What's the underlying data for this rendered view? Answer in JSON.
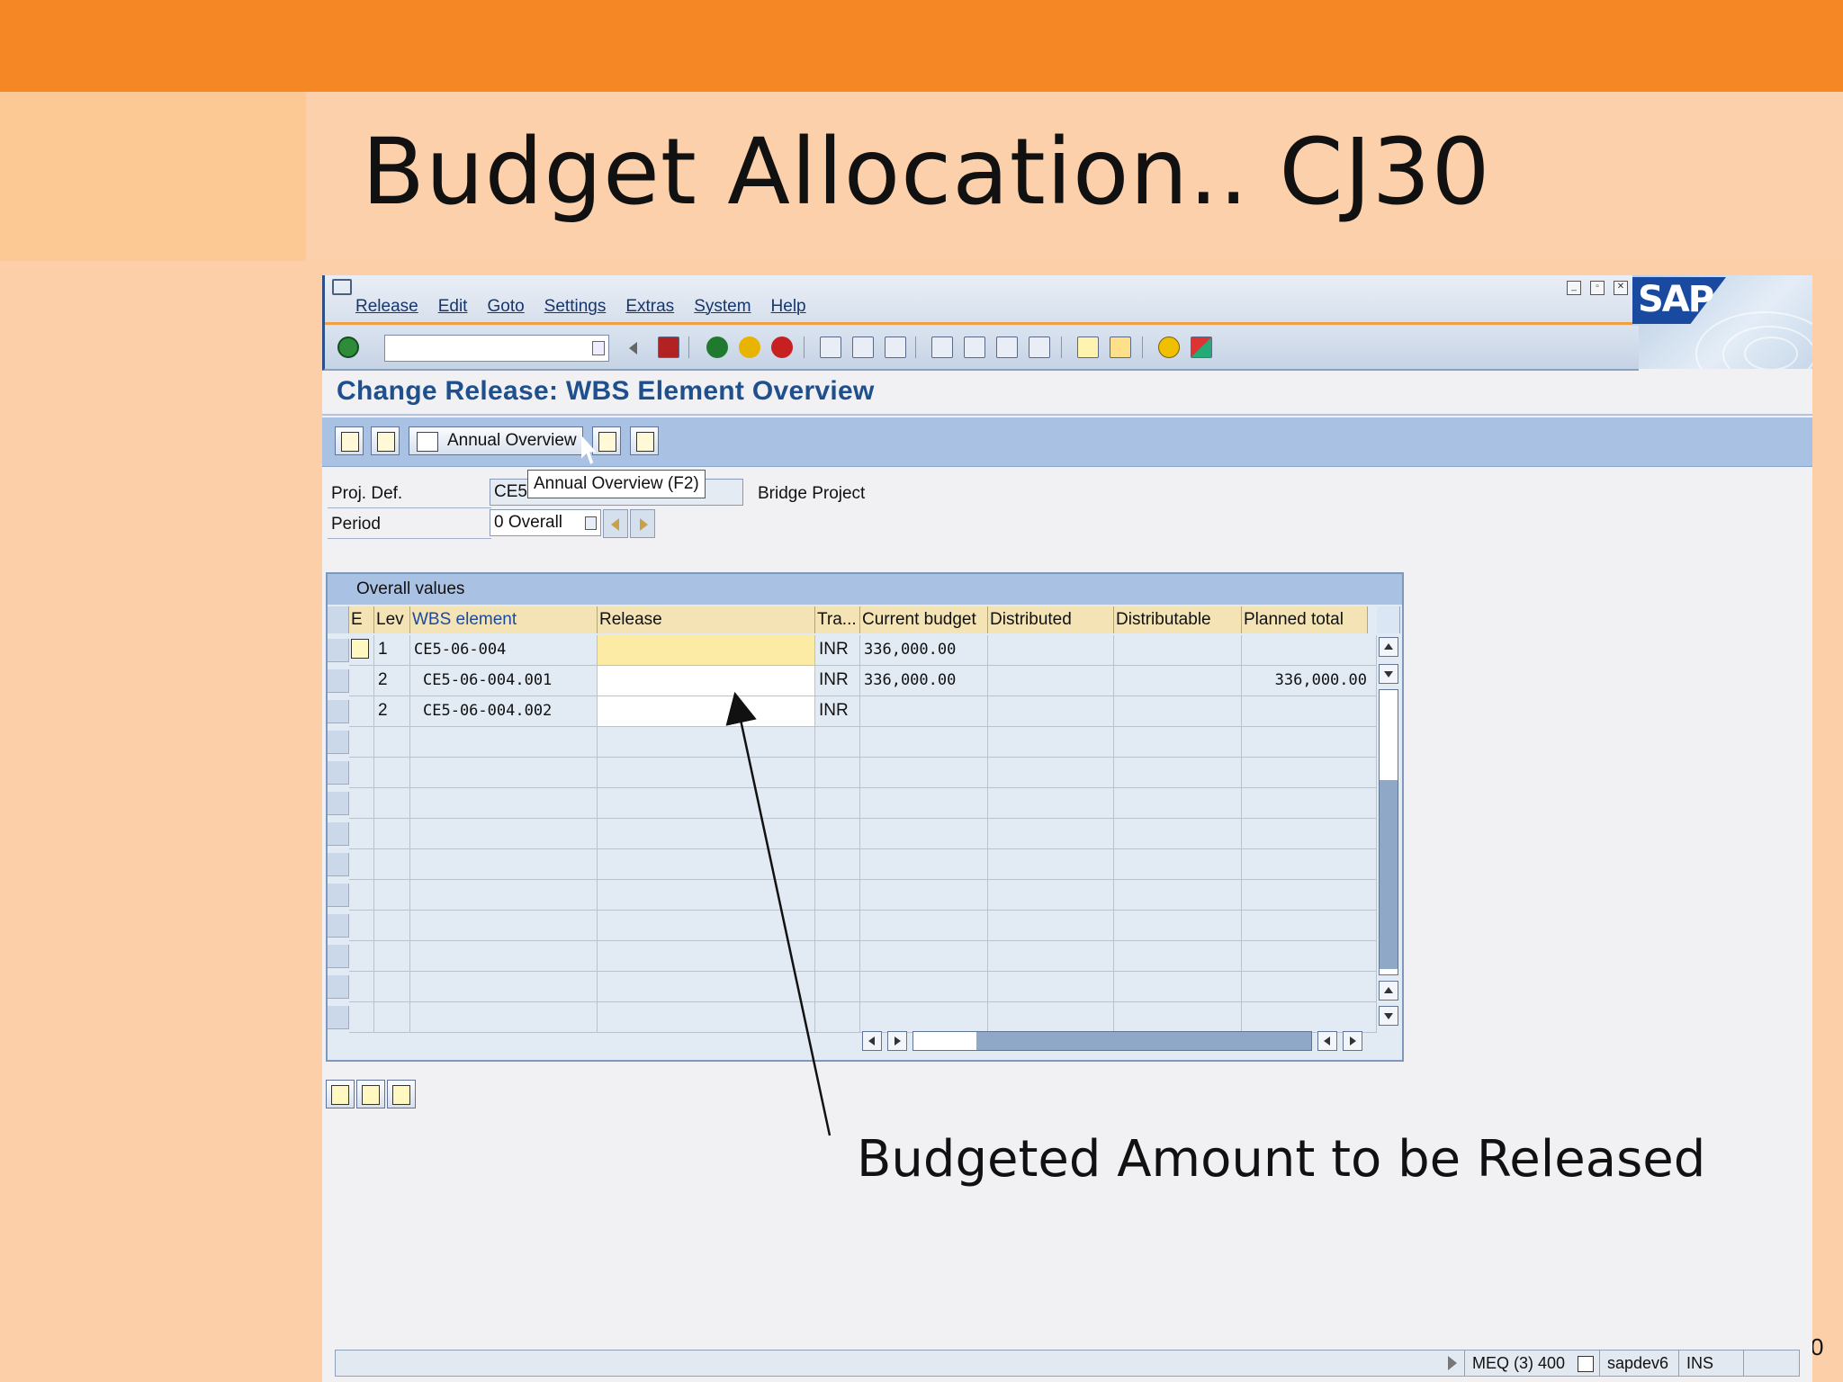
{
  "slide": {
    "title": "Budget Allocation.. CJ30",
    "annotation": "Budgeted Amount to be Released",
    "page_number": "0"
  },
  "menu": {
    "items": [
      "Release",
      "Edit",
      "Goto",
      "Settings",
      "Extras",
      "System",
      "Help"
    ]
  },
  "logo": {
    "text": "SAP"
  },
  "screen": {
    "title": "Change Release: WBS Element Overview"
  },
  "app_toolbar": {
    "annual_overview_label": "Annual Overview",
    "tooltip": "Annual Overview   (F2)"
  },
  "header_fields": {
    "proj_def_label": "Proj. Def.",
    "proj_def_value": "CE5",
    "project_name": "Bridge Project",
    "period_label": "Period",
    "period_value": "0 Overall"
  },
  "table": {
    "title": "Overall values",
    "columns": [
      "E",
      "Lev",
      "WBS element",
      "Release",
      "Tra...",
      "Current budget",
      "Distributed",
      "Distributable",
      "Planned total"
    ],
    "rows": [
      {
        "lev": "1",
        "wbs": "CE5-06-004",
        "release": "",
        "tra": "INR",
        "current_budget": "336,000.00",
        "distributed": "",
        "distributable": "",
        "planned_total": ""
      },
      {
        "lev": "2",
        "wbs": "CE5-06-004.001",
        "release": "",
        "tra": "INR",
        "current_budget": "336,000.00",
        "distributed": "",
        "distributable": "",
        "planned_total": "336,000.00"
      },
      {
        "lev": "2",
        "wbs": "CE5-06-004.002",
        "release": "",
        "tra": "INR",
        "current_budget": "",
        "distributed": "",
        "distributable": "",
        "planned_total": ""
      }
    ]
  },
  "status": {
    "system": "MEQ (3) 400",
    "server": "sapdev6",
    "mode": "INS"
  },
  "colors": {
    "slide_orange": "#f58825",
    "slide_peach": "#fccfa8",
    "sap_blue": "#1f4f8c",
    "header_yellow": "#f4e3b4",
    "input_yellow": "#fbeba4"
  }
}
